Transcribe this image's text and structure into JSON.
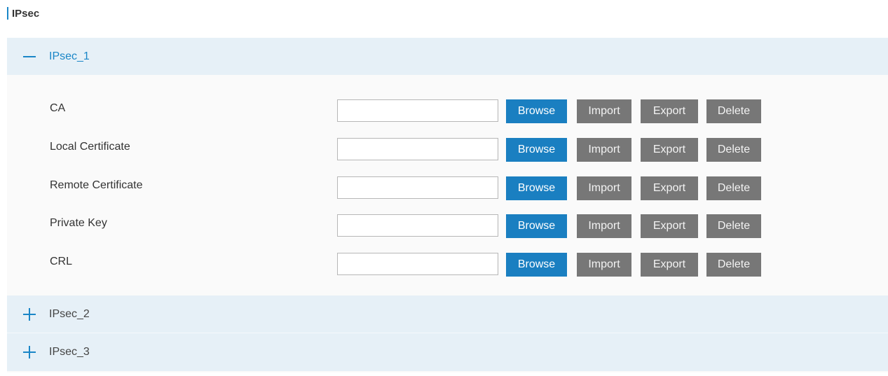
{
  "section": {
    "title": "IPsec"
  },
  "accordion": {
    "items": [
      {
        "label": "IPsec_1",
        "expanded": true,
        "icon": "minus-icon"
      },
      {
        "label": "IPsec_2",
        "expanded": false,
        "icon": "plus-icon"
      },
      {
        "label": "IPsec_3",
        "expanded": false,
        "icon": "plus-icon"
      }
    ]
  },
  "certificates": {
    "rows": [
      {
        "label": "CA",
        "value": ""
      },
      {
        "label": "Local Certificate",
        "value": ""
      },
      {
        "label": "Remote Certificate",
        "value": ""
      },
      {
        "label": "Private Key",
        "value": ""
      },
      {
        "label": "CRL",
        "value": ""
      }
    ]
  },
  "buttons": {
    "browse": "Browse",
    "import": "Import",
    "export": "Export",
    "delete": "Delete"
  },
  "colors": {
    "accent": "#1a86c7",
    "browse_button": "#1a7fc1",
    "secondary_button": "#777777",
    "accordion_header": "#e6f0f7",
    "panel_background": "#fafafa"
  }
}
